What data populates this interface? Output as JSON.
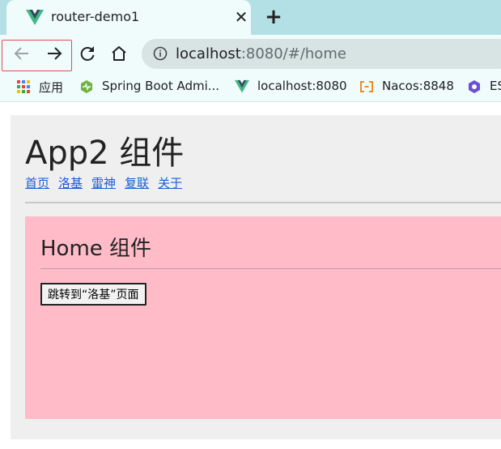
{
  "tab": {
    "title": "router-demo1",
    "close_glyph": "✕",
    "favicon": "vue-logo-icon"
  },
  "new_tab_glyph": "+",
  "toolbar": {
    "back_icon": "back-arrow-icon",
    "forward_icon": "forward-arrow-icon",
    "reload_icon": "reload-icon",
    "home_icon": "home-icon"
  },
  "address": {
    "host": "localhost",
    "rest": ":8080/#/home"
  },
  "bookmarks": [
    {
      "label": "应用",
      "icon": "apps-grid-icon"
    },
    {
      "label": "Spring Boot Admi...",
      "icon": "spring-boot-admin-icon"
    },
    {
      "label": "localhost:8080",
      "icon": "vue-logo-icon"
    },
    {
      "label": "Nacos:8848",
      "icon": "nacos-icon"
    },
    {
      "label": "ES",
      "icon": "hexagon-icon"
    }
  ],
  "page": {
    "app_title": "App2 组件",
    "nav_links": [
      "首页",
      "洛基",
      "雷神",
      "复联",
      "关于"
    ],
    "home": {
      "title": "Home 组件",
      "button_label": "跳转到“洛基”页面",
      "background": "#ffbcc8"
    }
  },
  "colors": {
    "tabstrip": "#b3e0e4",
    "chrome": "#f0fbfb",
    "omnibox": "#d8e3e4",
    "link": "#1a5fd6",
    "app_background": "#efefef",
    "nav_highlight_border": "#e05050"
  }
}
